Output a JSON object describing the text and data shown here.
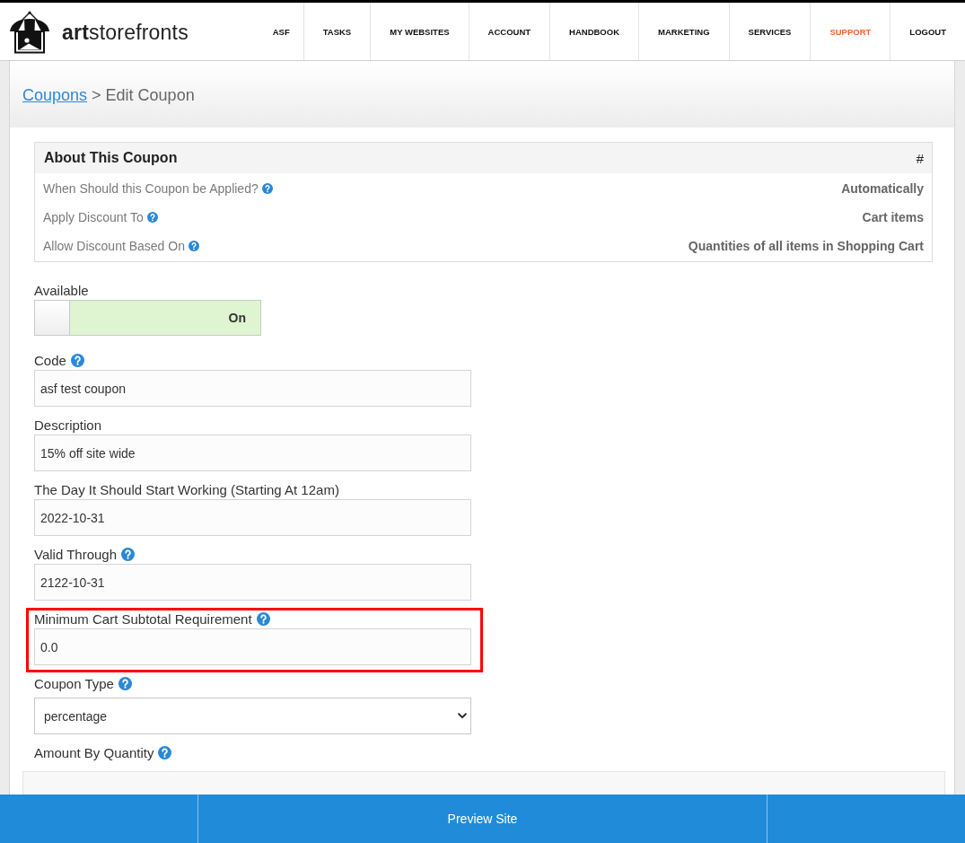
{
  "header": {
    "logo_text": "**art**storefronts",
    "nav": [
      {
        "label": "ASF",
        "highlighted": false
      },
      {
        "label": "TASKS",
        "highlighted": false
      },
      {
        "label": "MY WEBSITES",
        "highlighted": false
      },
      {
        "label": "ACCOUNT",
        "highlighted": false
      },
      {
        "label": "HANDBOOK",
        "highlighted": false
      },
      {
        "label": "MARKETING",
        "highlighted": false
      },
      {
        "label": "SERVICES",
        "highlighted": false
      },
      {
        "label": "SUPPORT",
        "highlighted": true
      },
      {
        "label": "LOGOUT",
        "highlighted": false
      }
    ]
  },
  "breadcrumb": {
    "link": "Coupons",
    "separator": ">",
    "current": "Edit Coupon"
  },
  "summary": {
    "title": "About This Coupon",
    "corner": "#",
    "rows": [
      {
        "label": "When Should this Coupon be Applied?",
        "help": true,
        "value": "Automatically"
      },
      {
        "label": "Apply Discount To",
        "help": true,
        "value": "Cart items"
      },
      {
        "label": "Allow Discount Based On",
        "help": true,
        "value": "Quantities of all items in Shopping Cart"
      }
    ]
  },
  "form": {
    "fields": [
      {
        "kind": "toggle",
        "label": "Available",
        "help": false,
        "on": true,
        "state_label": "On",
        "highlighted": false
      },
      {
        "kind": "text",
        "label": "Code",
        "help": true,
        "value": "asf test coupon",
        "highlighted": false
      },
      {
        "kind": "text",
        "label": "Description",
        "help": false,
        "value": "15% off site wide",
        "highlighted": false
      },
      {
        "kind": "text",
        "label": "The Day It Should Start Working (Starting At 12am)",
        "help": false,
        "value": "2022-10-31",
        "highlighted": false
      },
      {
        "kind": "text",
        "label": "Valid Through",
        "help": true,
        "value": "2122-10-31",
        "highlighted": false
      },
      {
        "kind": "text",
        "label": "Minimum Cart Subtotal Requirement",
        "help": true,
        "value": "0.0",
        "highlighted": true
      },
      {
        "kind": "select",
        "label": "Coupon Type",
        "help": true,
        "value": "percentage",
        "highlighted": false
      },
      {
        "kind": "table",
        "label": "Amount By Quantity",
        "help": true,
        "highlighted": false
      }
    ]
  },
  "footer": {
    "action": "Preview Site"
  }
}
